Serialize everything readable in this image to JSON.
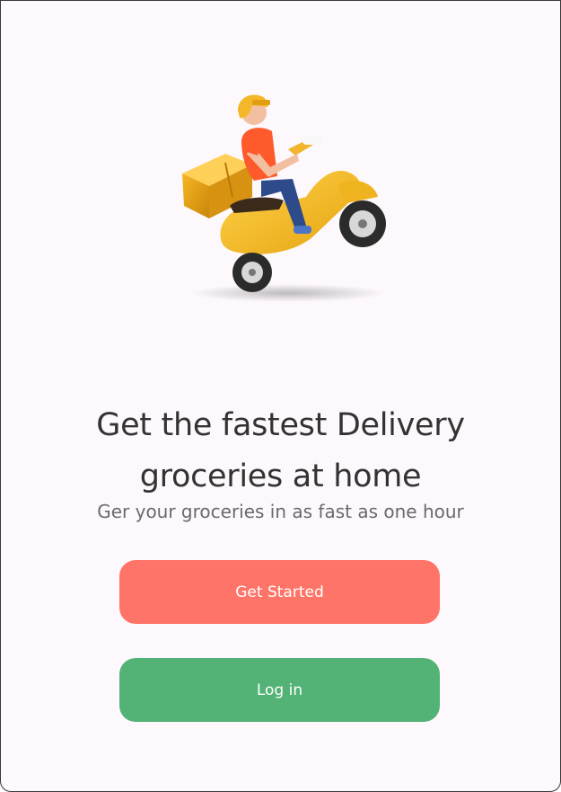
{
  "onboarding": {
    "title_line1": "Get the fastest Delivery",
    "title_line2": "groceries at home",
    "subtitle": "Ger your groceries in as fast as one hour",
    "get_started_label": "Get Started",
    "login_label": "Log in"
  },
  "colors": {
    "background": "#fdf8fc",
    "primary_button": "#ff7468",
    "secondary_button": "#53b276",
    "title_text": "#333333",
    "subtitle_text": "#6a6a6a"
  },
  "illustration": {
    "icon": "delivery-scooter-icon"
  }
}
